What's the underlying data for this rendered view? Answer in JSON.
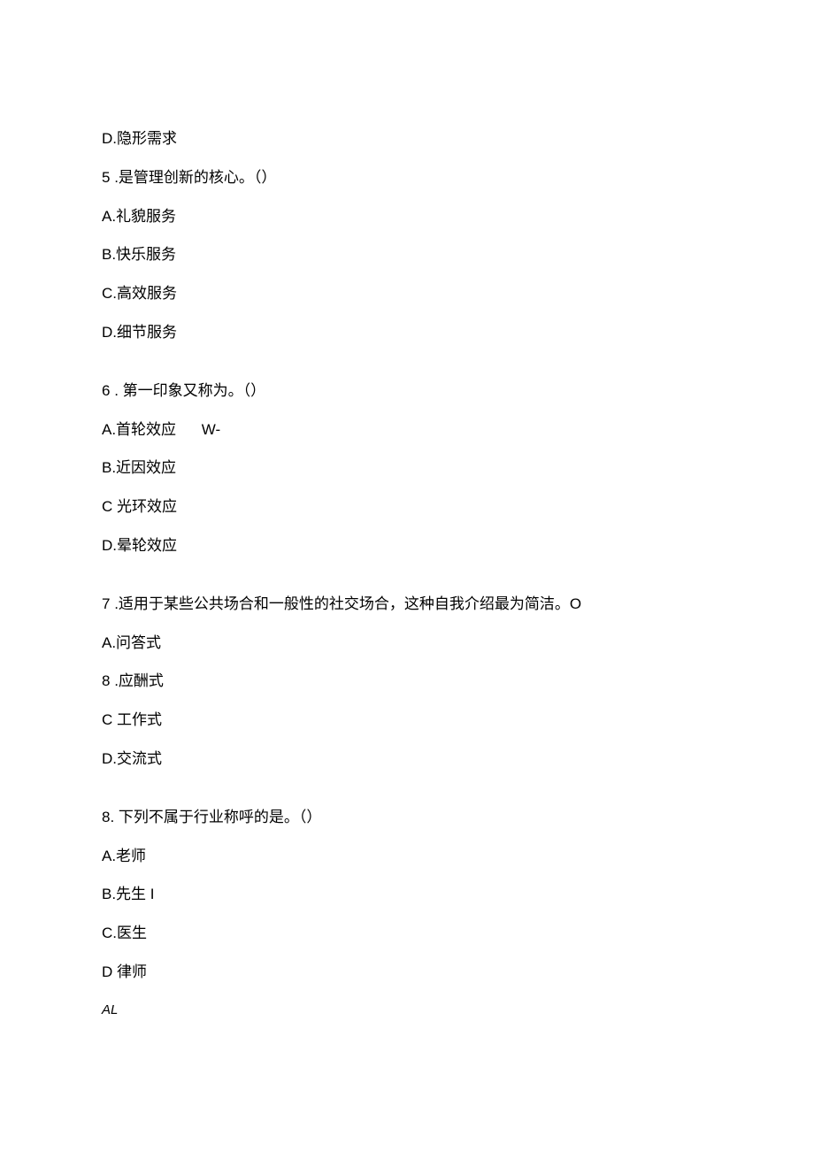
{
  "lines": {
    "l1": "D.隐形需求",
    "q5_num": "5",
    "q5_text": " .是管理创新的核心。（）",
    "l3": "A.礼貌服务",
    "l4": "B.快乐服务",
    "l5": "C.高效服务",
    "l6": "D.细节服务",
    "q6_num": "6",
    "q6_text": " . 第一印象又称为。（）",
    "l8a": "A.首轮效应",
    "l8b": "W-",
    "l9": "B.近因效应",
    "l10": "C 光环效应",
    "l11": "D.晕轮效应",
    "q7_num": "7",
    "q7_text": " .适用于某些公共场合和一般性的社交场合，这种自我介绍最为简洁。O",
    "l13": "A.问答式",
    "q8a_num": "8",
    "q8a_text": " .应酬式",
    "l15": "C 工作式",
    "l16": "D.交流式",
    "q8b_num": "8.",
    "q8b_text": " 下列不属于行业称呼的是。（）",
    "l18": "A.老师",
    "l19": "B.先生 I",
    "l20": "C.医生",
    "l21": "D 律师",
    "l22": "AL"
  }
}
